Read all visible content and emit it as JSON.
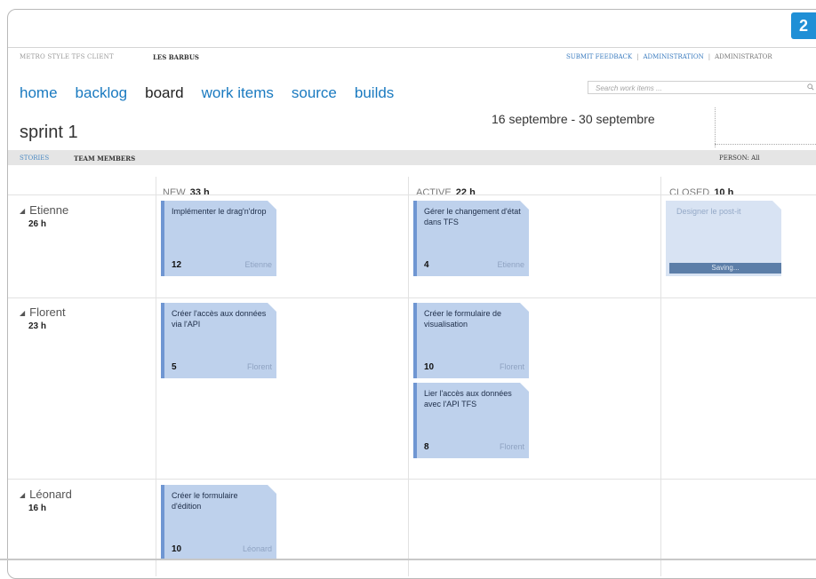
{
  "page_number": "2",
  "header": {
    "app_title": "METRO STYLE TFS CLIENT",
    "project": "LES BARBUS",
    "links": [
      "SUBMIT FEEDBACK",
      "ADMINISTRATION",
      "ADMINISTRATOR"
    ]
  },
  "nav": [
    "home",
    "backlog",
    "board",
    "work items",
    "source",
    "builds"
  ],
  "search_placeholder": "Search work items ...",
  "sprint_title": "sprint 1",
  "date_range": "16 septembre - 30 septembre",
  "subbar": {
    "stories": "STORIES",
    "team_members": "TEAM MEMBERS",
    "person_filter": "PERSON: All"
  },
  "columns": [
    {
      "label": "NEW",
      "hours": "33 h"
    },
    {
      "label": "ACTIVE",
      "hours": "22 h"
    },
    {
      "label": "CLOSED",
      "hours": "10 h"
    }
  ],
  "rows": [
    {
      "name": "Etienne",
      "hours": "26 h"
    },
    {
      "name": "Florent",
      "hours": "23 h"
    },
    {
      "name": "Léonard",
      "hours": "16 h"
    }
  ],
  "cards": [
    {
      "title": "Implémenter le drag'n'drop",
      "hours": "12",
      "owner": "Etienne"
    },
    {
      "title": "Gérer le changement d'état dans TFS",
      "hours": "4",
      "owner": "Etienne"
    },
    {
      "title": "Designer le post-it",
      "status": "Saving..."
    },
    {
      "title": "Créer l'accès aux données via l'API",
      "hours": "5",
      "owner": "Florent"
    },
    {
      "title": "Créer le formulaire de visualisation",
      "hours": "10",
      "owner": "Florent"
    },
    {
      "title": "Lier l'accès aux données avec l'API TFS",
      "hours": "8",
      "owner": "Florent"
    },
    {
      "title": "Créer le formulaire d'édition",
      "hours": "10",
      "owner": "Léonard"
    }
  ],
  "colors": {
    "accent": "#1a7ac0",
    "card": "#bed1ec",
    "card_border": "#6f96d2",
    "page_badge": "#1f8fd6"
  }
}
